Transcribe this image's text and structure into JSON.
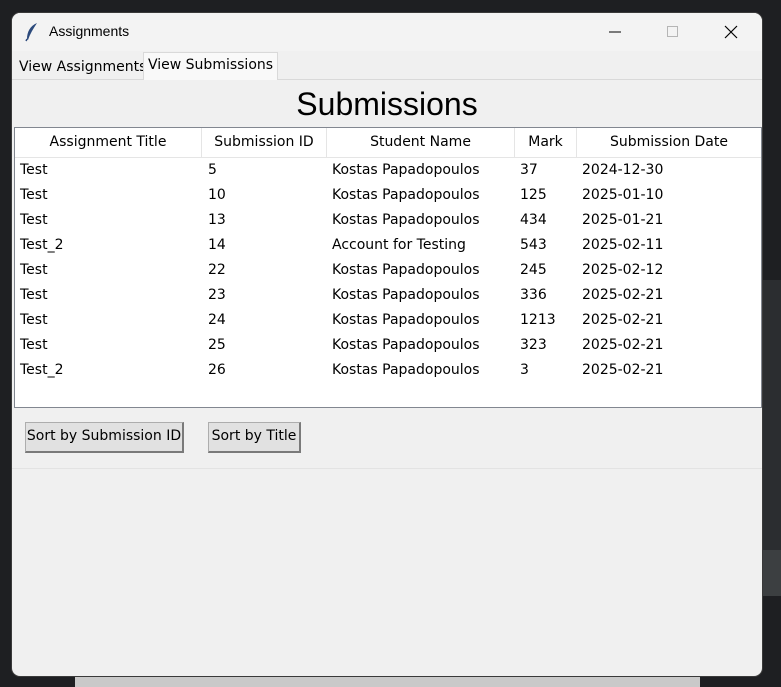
{
  "window": {
    "title": "Assignments"
  },
  "tabs": [
    {
      "label": "View Assignments",
      "active": false
    },
    {
      "label": "View Submissions",
      "active": true
    }
  ],
  "heading": "Submissions",
  "table": {
    "columns": [
      "Assignment Title",
      "Submission ID",
      "Student Name",
      "Mark",
      "Submission Date"
    ],
    "rows": [
      [
        "Test",
        "5",
        "Kostas Papadopoulos",
        "37",
        "2024-12-30"
      ],
      [
        "Test",
        "10",
        "Kostas Papadopoulos",
        "125",
        "2025-01-10"
      ],
      [
        "Test",
        "13",
        "Kostas Papadopoulos",
        "434",
        "2025-01-21"
      ],
      [
        "Test_2",
        "14",
        "Account for Testing",
        "543",
        "2025-02-11"
      ],
      [
        "Test",
        "22",
        "Kostas Papadopoulos",
        "245",
        "2025-02-12"
      ],
      [
        "Test",
        "23",
        "Kostas Papadopoulos",
        "336",
        "2025-02-21"
      ],
      [
        "Test",
        "24",
        "Kostas Papadopoulos",
        "1213",
        "2025-02-21"
      ],
      [
        "Test",
        "25",
        "Kostas Papadopoulos",
        "323",
        "2025-02-21"
      ],
      [
        "Test_2",
        "26",
        "Kostas Papadopoulos",
        "3",
        "2025-02-21"
      ]
    ]
  },
  "buttons": {
    "sort_id": "Sort by Submission ID",
    "sort_title": "Sort by Title"
  },
  "icons": {
    "app": "feather-icon",
    "minimize": "minimize-icon",
    "maximize": "maximize-icon",
    "close": "close-icon"
  }
}
